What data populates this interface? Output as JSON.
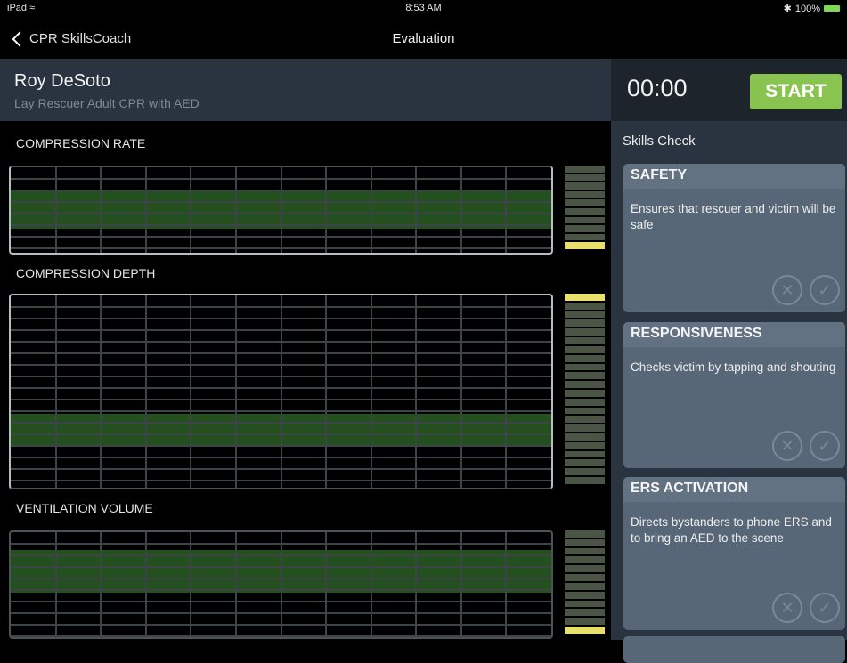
{
  "status_bar": {
    "device": "iPad",
    "time": "8:53 AM",
    "battery": "100%"
  },
  "nav": {
    "back_label": "CPR SkillsCoach",
    "title": "Evaluation"
  },
  "student": {
    "name": "Roy DeSoto",
    "course": "Lay Rescuer Adult CPR with AED"
  },
  "timer": {
    "value": "00:00",
    "start_label": "START"
  },
  "charts": {
    "compression_rate": {
      "label": "COMPRESSION RATE",
      "meter_level": "bottom"
    },
    "compression_depth": {
      "label": "COMPRESSION DEPTH",
      "meter_level": "top"
    },
    "ventilation_volume": {
      "label": "VENTILATION VOLUME",
      "meter_level": "bottom"
    }
  },
  "skills_check": {
    "title": "Skills Check",
    "cards": [
      {
        "title": "SAFETY",
        "description": "Ensures that rescuer and victim will be safe"
      },
      {
        "title": "RESPONSIVENESS",
        "description": "Checks victim by tapping and shouting"
      },
      {
        "title": "ERS ACTIVATION",
        "description": "Directs bystanders to phone ERS and to bring an AED to the scene"
      }
    ]
  },
  "icons": {
    "back": "chevron-left-icon",
    "wifi": "wifi-icon",
    "bluetooth": "bluetooth-icon",
    "battery": "battery-icon",
    "fail": "cross-circle-icon",
    "pass": "check-circle-icon"
  },
  "colors": {
    "accent_green": "#88c44f",
    "band_green": "#24501f",
    "meter_lit": "#e9e06c",
    "panel": "#2a3440",
    "card": "#586777"
  }
}
